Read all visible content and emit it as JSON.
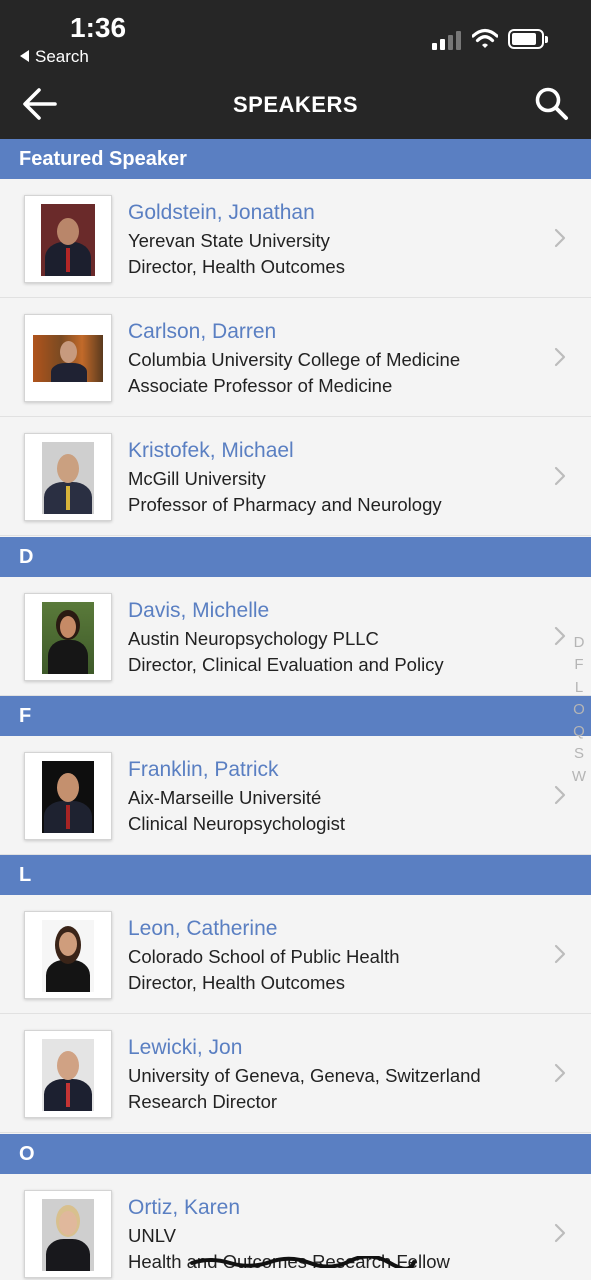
{
  "status_bar": {
    "time": "1:36",
    "back_label": "Search"
  },
  "nav": {
    "title": "SPEAKERS"
  },
  "colors": {
    "accent": "#5a7fc2",
    "nav_bg": "#262626",
    "row_bg": "#f4f4f4"
  },
  "icons": {
    "back": "arrow-left-icon",
    "search": "search-icon",
    "row": "chevron-right-icon"
  },
  "sections": [
    {
      "header": "Featured Speaker"
    },
    {
      "header": "D"
    },
    {
      "header": "F"
    },
    {
      "header": "L"
    },
    {
      "header": "O"
    }
  ],
  "speakers": [
    {
      "name": "Goldstein, Jonathan",
      "org": "Yerevan State University",
      "role": "Director, Health Outcomes"
    },
    {
      "name": "Carlson, Darren",
      "org": "Columbia University College of Medicine",
      "role": "Associate Professor of Medicine"
    },
    {
      "name": "Kristofek, Michael",
      "org": "McGill University",
      "role": "Professor of Pharmacy and Neurology"
    },
    {
      "name": "Davis, Michelle",
      "org": "Austin Neuropsychology PLLC",
      "role": "Director, Clinical Evaluation and Policy"
    },
    {
      "name": "Franklin, Patrick",
      "org": "Aix-Marseille Université",
      "role": "Clinical Neuropsychologist"
    },
    {
      "name": "Leon, Catherine",
      "org": "Colorado School of Public Health",
      "role": "Director, Health Outcomes"
    },
    {
      "name": "Lewicki, Jon",
      "org": "University of Geneva, Geneva, Switzerland",
      "role": "Research Director"
    },
    {
      "name": "Ortiz, Karen",
      "org": "UNLV",
      "role": "Health and Outcomes Research Fellow"
    }
  ],
  "index_letters": [
    "D",
    "F",
    "L",
    "O",
    "Q",
    "S",
    "W"
  ]
}
